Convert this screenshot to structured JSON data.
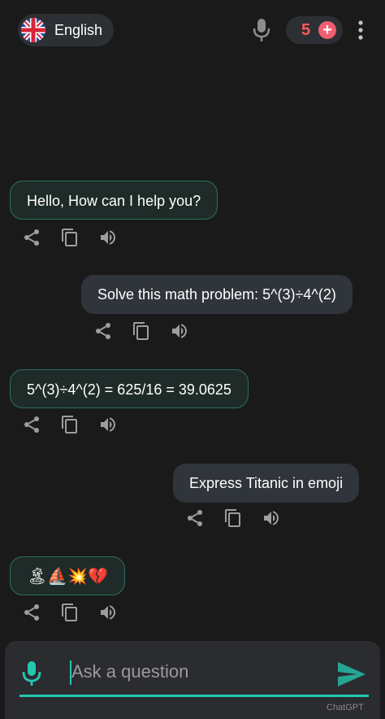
{
  "header": {
    "language": "English",
    "credits": "5",
    "plus_label": "+"
  },
  "messages": [
    {
      "role": "bot",
      "text": "Hello, How can I help you?"
    },
    {
      "role": "user",
      "text": "Solve this math problem: 5^(3)÷4^(2)"
    },
    {
      "role": "bot",
      "text": "5^(3)÷4^(2) = 625/16 = 39.0625"
    },
    {
      "role": "user",
      "text": "Express Titanic in emoji"
    },
    {
      "role": "bot",
      "text": "🏝⛵💥💔"
    }
  ],
  "composer": {
    "placeholder": "Ask a question",
    "brand": "ChatGPT"
  },
  "colors": {
    "background": "#1a1a1a",
    "accent": "#26c6b0",
    "bot_bubble_border": "#2f6e61",
    "credits": "#ff5a5a"
  },
  "icons": [
    "uk-flag-icon",
    "microphone-icon",
    "plus-icon",
    "more-vertical-icon",
    "share-icon",
    "copy-icon",
    "speaker-icon",
    "send-icon"
  ]
}
